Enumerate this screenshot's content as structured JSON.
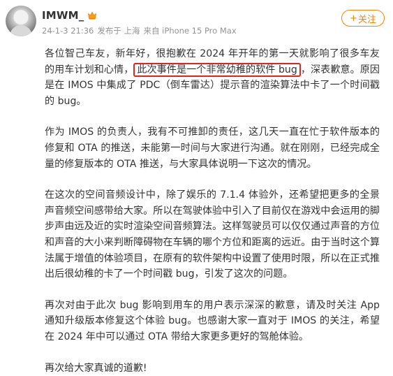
{
  "user": {
    "name": "IMWM_",
    "avatar_icon": "person-silhouette-avatar",
    "badge_icon": "crown-badge-icon"
  },
  "meta": {
    "time": "24-1-3 21:36",
    "posted_from": "发布于 上海",
    "device": "来自 iPhone 15 Pro Max"
  },
  "follow_button": {
    "plus": "+",
    "label": "关注"
  },
  "post": {
    "p1_before": "各位智己车友，新年好，很抱歉在 2024 年开年的第一天就影响了很多车友的用车计划和心情，",
    "p1_highlight": "此次事件是一个非常幼稚的软件 bug",
    "p1_after": "，深表歉意。原因是在 IMOS 中集成了 PDC（倒车雷达）提示音的渲染算法中卡了一个时间戳的 bug。",
    "p2": "作为 IMOS 的负责人，我有不可推卸的责任，这几天一直在忙于软件版本的修复和 OTA 的推送，未能第一时间与大家进行沟通。就在刚刚，已经完成全量的修复版本的 OTA 推送，与大家具体说明一下这次的情况。",
    "p3": "在这次的空间音频设计中，除了娱乐的 7.1.4 体验外，还希望把更多的全景声音频空间感带给大家。所以在驾驶体验中引入了目前仅在游戏中会运用的脚步声由远及近的实时渲染空间音频算法。这样驾驶员可以仅仅通过声音的方位和声音的大小来判断障碍物在车辆的哪个方位和距离的远近。由于当时这个算法属于增值的体验项目，在原有的软件架构中设置了使用时限，所以在正式推出后很幼稚的卡了一个时间戳 bug，引发了这次的问题。",
    "p4": "再次对由于此次 bug 影响到用车的用户表示深深的歉意，请及时关注 App 通知升级版本修复这个体验 bug。也感谢大家一直对于 IMOS 的关注，希望在 2024 年中可以通过 OTA 带给大家更多更好的驾舱体验。",
    "p5": "再次给大家真诚的道歉!"
  },
  "colors": {
    "accent": "#ff8200",
    "highlight_border": "#e8221b",
    "meta_text": "#939393",
    "body_text": "#333333"
  }
}
